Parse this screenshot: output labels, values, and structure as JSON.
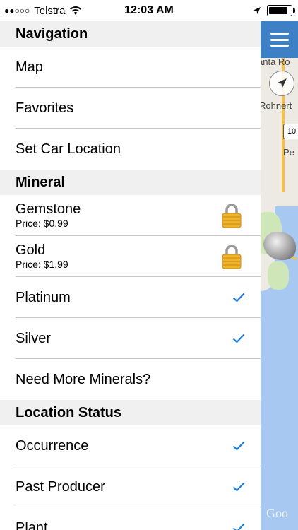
{
  "status_bar": {
    "signal_dots": "●●○○○",
    "carrier": "Telstra",
    "time": "12:03 AM"
  },
  "map": {
    "labels": {
      "town1": "anta Ro",
      "town2": "Rohnert",
      "town3": "Pe",
      "highway": "10",
      "attribution": "Goo"
    }
  },
  "menu": {
    "sections": [
      {
        "title": "Navigation",
        "items": [
          {
            "label": "Map"
          },
          {
            "label": "Favorites"
          },
          {
            "label": "Set Car Location"
          }
        ]
      },
      {
        "title": "Mineral",
        "items": [
          {
            "label": "Gemstone",
            "price": "Price: $0.99",
            "accessory": "lock-icon"
          },
          {
            "label": "Gold",
            "price": "Price: $1.99",
            "accessory": "lock-icon"
          },
          {
            "label": "Platinum",
            "accessory": "checkmark-icon"
          },
          {
            "label": "Silver",
            "accessory": "checkmark-icon"
          },
          {
            "label": "Need More Minerals?"
          }
        ]
      },
      {
        "title": "Location Status",
        "items": [
          {
            "label": "Occurrence",
            "accessory": "checkmark-icon"
          },
          {
            "label": "Past Producer",
            "accessory": "checkmark-icon"
          },
          {
            "label": "Plant",
            "accessory": "checkmark-icon"
          }
        ]
      }
    ]
  },
  "colors": {
    "accent": "#1a7fe0",
    "header_bar": "#3e80c6",
    "section_bg": "#f0f0f0",
    "water": "#a7c8f0"
  }
}
